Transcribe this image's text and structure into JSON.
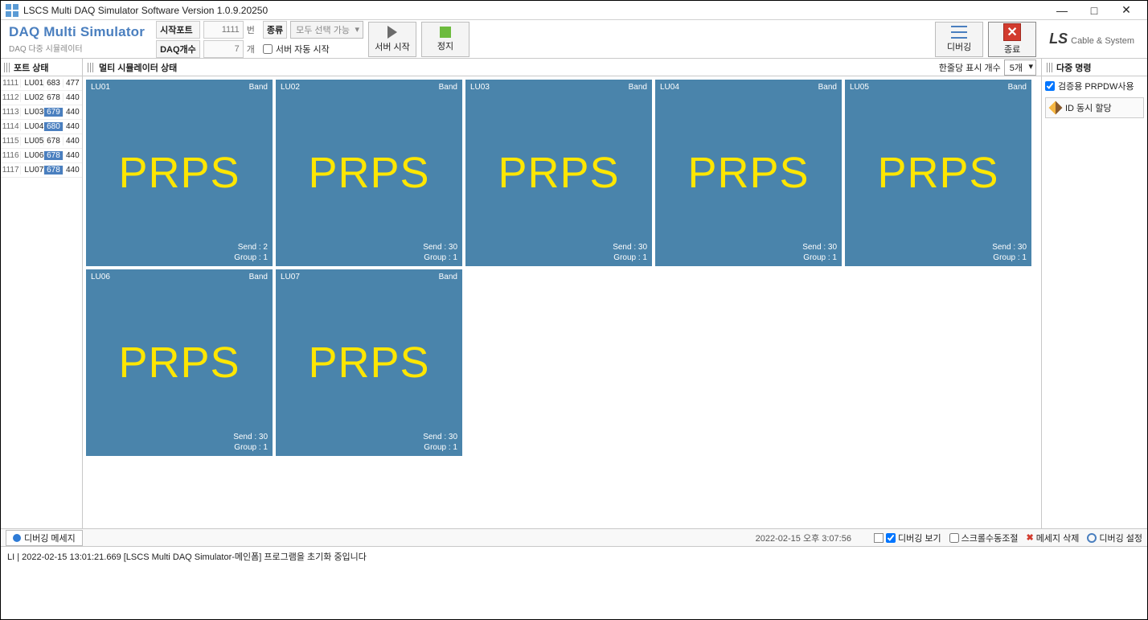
{
  "window": {
    "title": "LSCS Multi DAQ Simulator Software Version 1.0.9.20250"
  },
  "brand": {
    "title": "DAQ Multi Simulator",
    "subtitle": "DAQ 다중 시뮬레이터"
  },
  "params": {
    "start_port_label": "시작포트",
    "start_port_value": "1111",
    "start_port_unit": "번",
    "type_label": "종류",
    "type_value": "모두 선택 가능",
    "daq_count_label": "DAQ개수",
    "daq_count_value": "7",
    "daq_count_unit": "개",
    "server_autostart_label": "서버 자동 시작"
  },
  "buttons": {
    "server_start": "서버 시작",
    "stop": "정지",
    "debugging": "디버깅",
    "exit": "종료"
  },
  "logo": {
    "main": "LS",
    "sub": "Cable & System"
  },
  "headers": {
    "port_status": "포트 상태",
    "sim_status": "멀티 시뮬레이터 상태",
    "row_count_label": "한줄당 표시 개수",
    "row_count_value": "5개",
    "multi_cmd": "다중 명령"
  },
  "ports": [
    {
      "port": "1111",
      "name": "LU01",
      "v1": "683",
      "v2": "477",
      "hl": false
    },
    {
      "port": "1112",
      "name": "LU02",
      "v1": "678",
      "v2": "440",
      "hl": false
    },
    {
      "port": "1113",
      "name": "LU03",
      "v1": "679",
      "v2": "440",
      "hl": true
    },
    {
      "port": "1114",
      "name": "LU04",
      "v1": "680",
      "v2": "440",
      "hl": true
    },
    {
      "port": "1115",
      "name": "LU05",
      "v1": "678",
      "v2": "440",
      "hl": false
    },
    {
      "port": "1116",
      "name": "LU06",
      "v1": "678",
      "v2": "440",
      "hl": true
    },
    {
      "port": "1117",
      "name": "LU07",
      "v1": "678",
      "v2": "440",
      "hl": true
    }
  ],
  "tiles": [
    {
      "id": "LU01",
      "band": "Band",
      "big": "PRPS",
      "send": "Send : 2",
      "group": "Group : 1"
    },
    {
      "id": "LU02",
      "band": "Band",
      "big": "PRPS",
      "send": "Send : 30",
      "group": "Group : 1"
    },
    {
      "id": "LU03",
      "band": "Band",
      "big": "PRPS",
      "send": "Send : 30",
      "group": "Group : 1"
    },
    {
      "id": "LU04",
      "band": "Band",
      "big": "PRPS",
      "send": "Send : 30",
      "group": "Group : 1"
    },
    {
      "id": "LU05",
      "band": "Band",
      "big": "PRPS",
      "send": "Send : 30",
      "group": "Group : 1"
    },
    {
      "id": "LU06",
      "band": "Band",
      "big": "PRPS",
      "send": "Send : 30",
      "group": "Group : 1"
    },
    {
      "id": "LU07",
      "band": "Band",
      "big": "PRPS",
      "send": "Send : 30",
      "group": "Group : 1"
    }
  ],
  "right_panel": {
    "use_prpdw_label": "검증용 PRPDW사용",
    "assign_id_label": "ID 동시 할당"
  },
  "debug": {
    "tab_label": "디버깅 메세지",
    "timestamp": "2022-02-15 오후 3:07:56",
    "show_label": "디버깅 보기",
    "scroll_label": "스크롤수동조절",
    "delete_label": "메세지 삭제",
    "settings_label": "디버깅 설정",
    "log_line": "LI  |   2022-02-15 13:01:21.669 [LSCS Multi DAQ Simulator-메인폼] 프로그램을 초기화 중입니다"
  }
}
